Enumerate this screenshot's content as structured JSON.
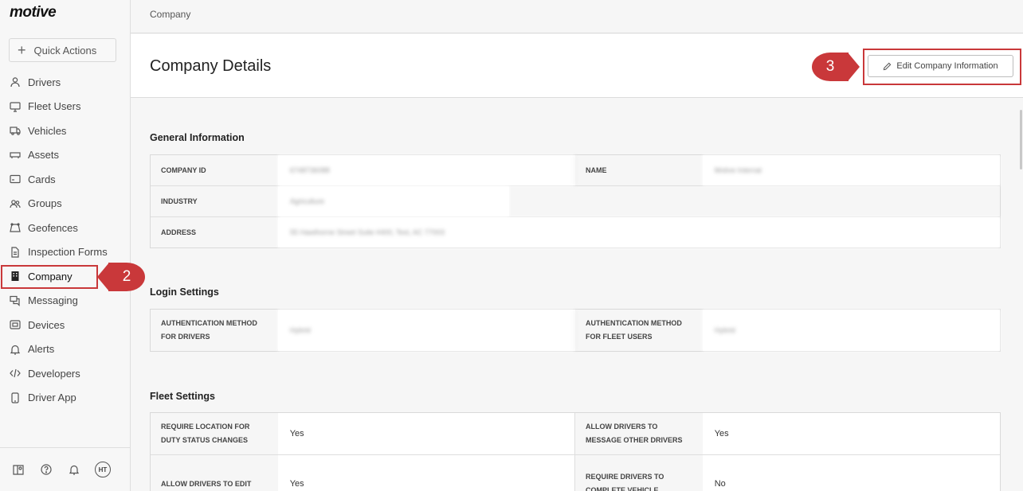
{
  "app": {
    "logo": "motive"
  },
  "sidebar": {
    "quick_actions": "Quick Actions",
    "items": [
      {
        "label": "Drivers",
        "icon": "person-icon"
      },
      {
        "label": "Fleet Users",
        "icon": "monitor-icon"
      },
      {
        "label": "Vehicles",
        "icon": "truck-icon"
      },
      {
        "label": "Assets",
        "icon": "trailer-icon"
      },
      {
        "label": "Cards",
        "icon": "card-icon"
      },
      {
        "label": "Groups",
        "icon": "group-icon"
      },
      {
        "label": "Geofences",
        "icon": "geofence-icon"
      },
      {
        "label": "Inspection Forms",
        "icon": "document-icon"
      },
      {
        "label": "Company",
        "icon": "building-icon",
        "active": true
      },
      {
        "label": "Messaging",
        "icon": "chat-icon"
      },
      {
        "label": "Devices",
        "icon": "device-icon"
      },
      {
        "label": "Alerts",
        "icon": "bell-icon"
      },
      {
        "label": "Developers",
        "icon": "code-icon"
      },
      {
        "label": "Driver App",
        "icon": "phone-icon"
      }
    ],
    "footer": {
      "avatar_initials": "HT"
    }
  },
  "badges": {
    "step2": "2",
    "step3": "3"
  },
  "colors": {
    "accent": "#c9383a"
  },
  "breadcrumb": "Company",
  "page": {
    "title": "Company Details",
    "edit_button": "Edit Company Information"
  },
  "sections": {
    "general": {
      "title": "General Information",
      "company_id_label": "COMPANY ID",
      "company_id_value": "6748736088",
      "name_label": "NAME",
      "name_value": "Motive Internal",
      "industry_label": "INDUSTRY",
      "industry_value": "Agriculture",
      "address_label": "ADDRESS",
      "address_value": "55 Hawthorne Street Suite #400, Test, AC 77003"
    },
    "login": {
      "title": "Login Settings",
      "auth_drivers_label": "AUTHENTICATION METHOD FOR DRIVERS",
      "auth_drivers_value": "Hybrid",
      "auth_fleet_label": "AUTHENTICATION METHOD FOR FLEET USERS",
      "auth_fleet_value": "Hybrid"
    },
    "fleet": {
      "title": "Fleet Settings",
      "req_location_label": "REQUIRE LOCATION FOR DUTY STATUS CHANGES",
      "req_location_value": "Yes",
      "allow_message_label": "ALLOW DRIVERS TO MESSAGE OTHER DRIVERS",
      "allow_message_value": "Yes",
      "allow_edit_label": "ALLOW DRIVERS TO EDIT",
      "allow_edit_value": "Yes",
      "req_inspection_label": "REQUIRE DRIVERS TO COMPLETE VEHICLE",
      "req_inspection_value": "No"
    }
  }
}
